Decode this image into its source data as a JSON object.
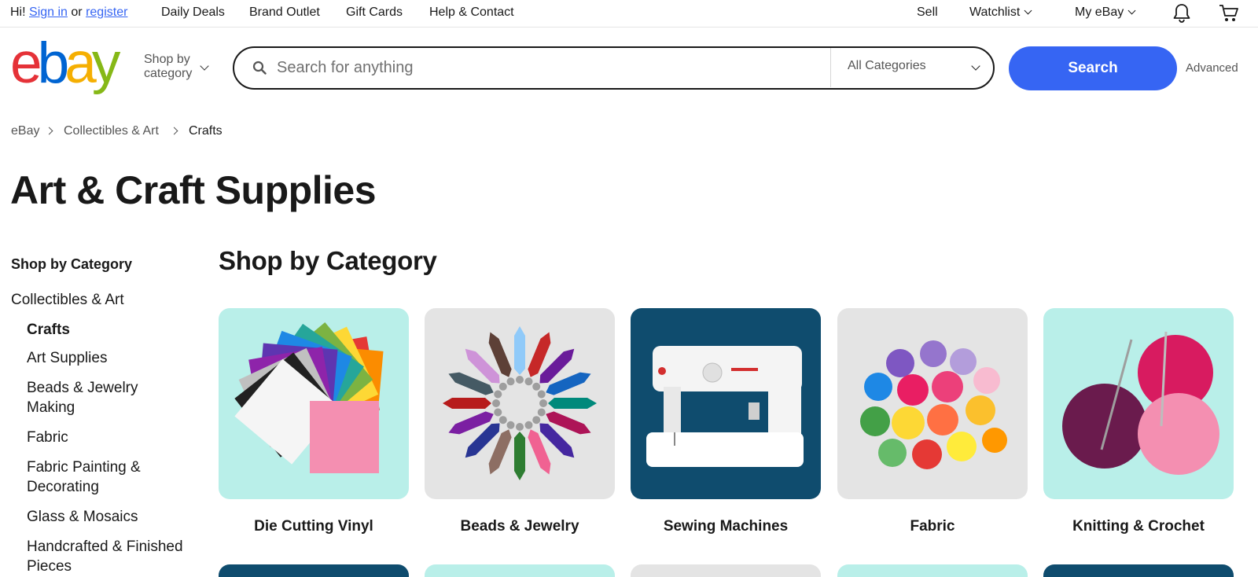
{
  "topbar": {
    "greeting": "Hi!",
    "sign_in": "Sign in",
    "or": "or",
    "register": "register",
    "links": [
      "Daily Deals",
      "Brand Outlet",
      "Gift Cards",
      "Help & Contact"
    ],
    "sell": "Sell",
    "watchlist": "Watchlist",
    "my_ebay": "My eBay",
    "icons": [
      "bell-icon",
      "cart-icon"
    ]
  },
  "header": {
    "logo_letters": [
      "e",
      "b",
      "a",
      "y"
    ],
    "logo_colors": [
      "#e53238",
      "#0064d2",
      "#f5af02",
      "#86b817"
    ],
    "shop_by_line1": "Shop by",
    "shop_by_line2": "category",
    "search_placeholder": "Search for anything",
    "category_select": "All Categories",
    "search_button": "Search",
    "advanced": "Advanced",
    "accent_color": "#3665f3"
  },
  "breadcrumb": [
    "eBay",
    "Collectibles & Art",
    "Crafts"
  ],
  "page_title": "Art & Craft Supplies",
  "sidebar": {
    "heading": "Shop by Category",
    "parent": "Collectibles & Art",
    "selected": "Crafts",
    "items": [
      "Art Supplies",
      "Beads & Jewelry",
      "Making",
      "Fabric",
      "Fabric Painting &",
      "Decorating",
      "Glass & Mosaics",
      "Handcrafted & Finished",
      "Pieces"
    ]
  },
  "main": {
    "heading": "Shop by Category",
    "tiles": [
      {
        "label": "Die Cutting Vinyl",
        "bg": "#b9efe9",
        "icon": "vinyl-fan-icon"
      },
      {
        "label": "Beads & Jewelry",
        "bg": "#e4e4e4",
        "icon": "crystal-pendants-icon"
      },
      {
        "label": "Sewing Machines",
        "bg": "#0f4c6e",
        "icon": "sewing-machine-icon"
      },
      {
        "label": "Fabric",
        "bg": "#e4e4e4",
        "icon": "fabric-rolls-icon"
      },
      {
        "label": "Knitting & Crochet",
        "bg": "#b9efe9",
        "icon": "yarn-balls-icon"
      }
    ],
    "row2_colors": [
      "#0f4c6e",
      "#b9efe9",
      "#e4e4e4",
      "#b9efe9",
      "#0f4c6e"
    ]
  }
}
